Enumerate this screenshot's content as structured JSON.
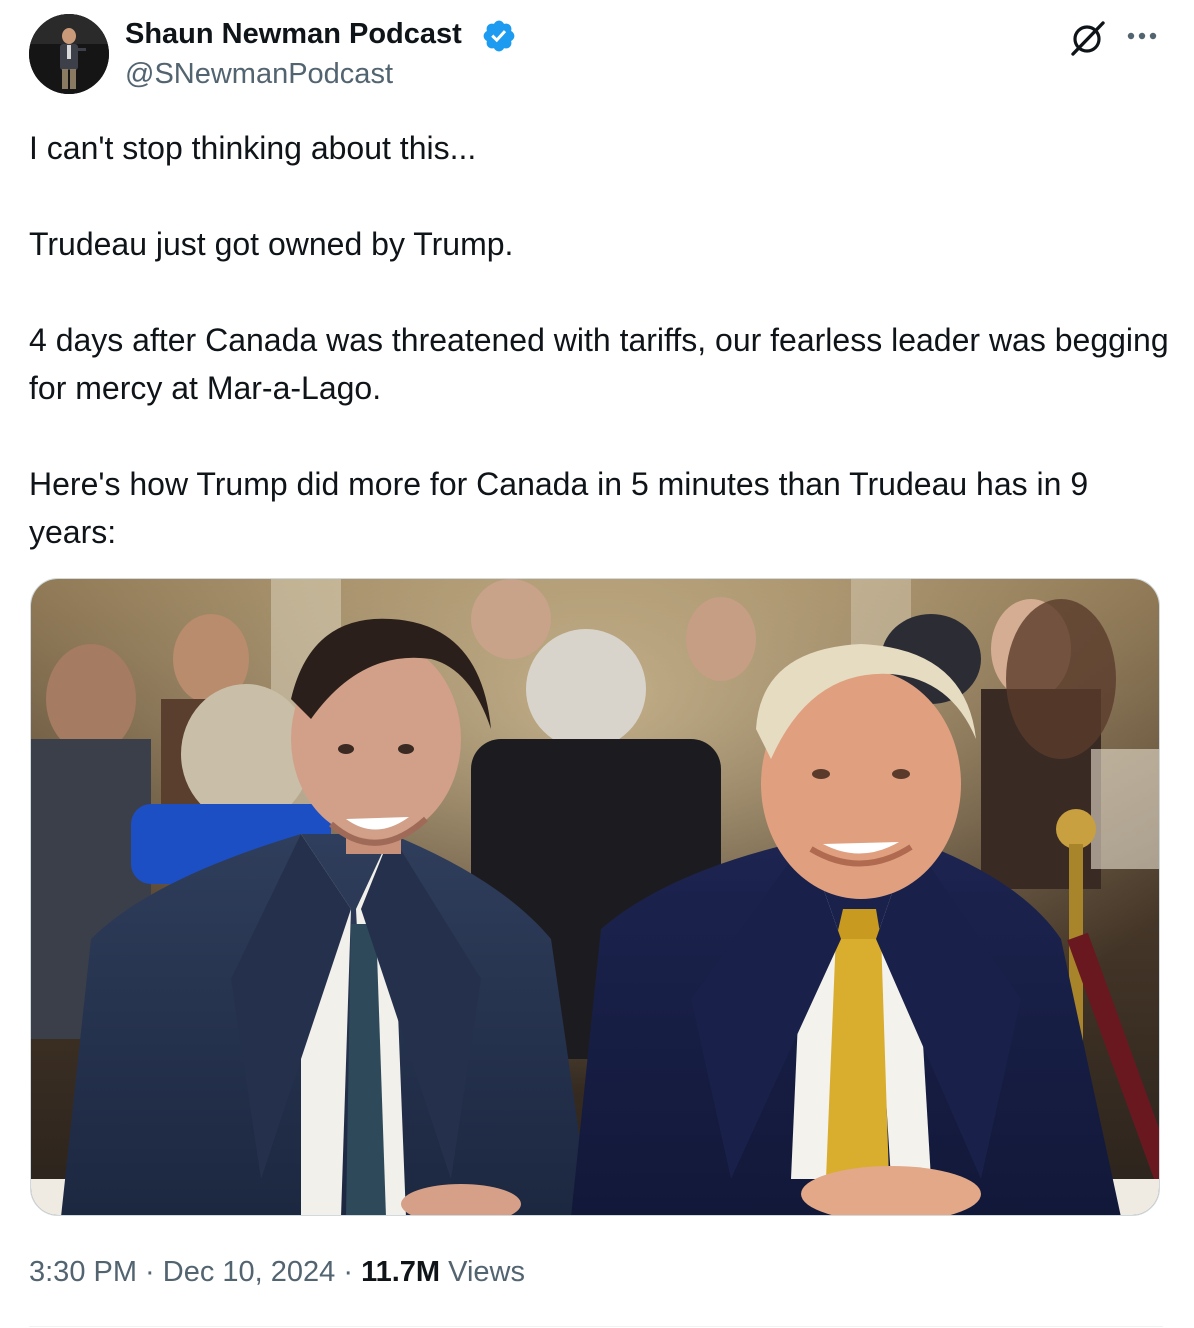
{
  "author": {
    "name": "Shaun Newman Podcast",
    "handle": "@SNewmanPodcast"
  },
  "icons": {
    "verified": "verified-badge-icon",
    "grok": "grok-icon",
    "more": "more-options-icon"
  },
  "colors": {
    "verified": "#1d9bf0",
    "text": "#0f1419",
    "secondary": "#536471"
  },
  "tweet": {
    "paragraphs": [
      "I can't stop thinking about this...",
      "Trudeau just got owned by Trump.",
      "4 days after Canada was threatened with tariffs, our fearless leader was begging for mercy at Mar-a-Lago.",
      "Here's how Trump did more for Canada in 5 minutes than Trudeau has in 9 years:"
    ]
  },
  "meta": {
    "time": "3:30 PM",
    "separator": " · ",
    "date": "Dec 10, 2024",
    "views_count": "11.7M",
    "views_label": "Views"
  }
}
